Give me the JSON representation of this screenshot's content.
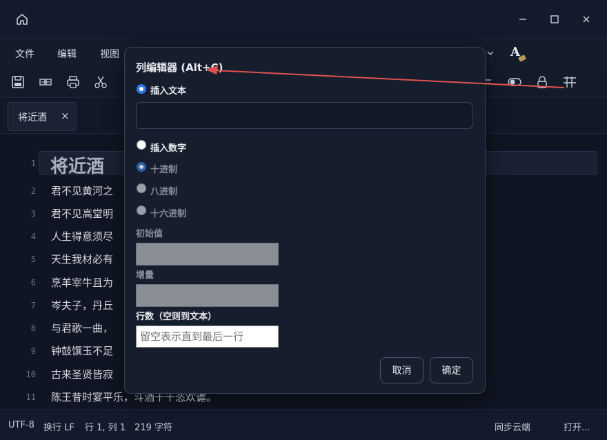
{
  "window": {
    "controls": [
      "minimize-icon",
      "maximize-icon",
      "close-icon"
    ]
  },
  "menubar": {
    "items": [
      "文件",
      "编辑",
      "视图"
    ],
    "font_icon": "A"
  },
  "tab": {
    "label": "将近酒",
    "close": "×"
  },
  "editor": {
    "lines": [
      {
        "num": "1",
        "text": "将近酒"
      },
      {
        "num": "2",
        "text": "君不见黄河之"
      },
      {
        "num": "3",
        "text": "君不见高堂明"
      },
      {
        "num": "4",
        "text": "人生得意须尽"
      },
      {
        "num": "5",
        "text": "天生我材必有"
      },
      {
        "num": "6",
        "text": "烹羊宰牛且为"
      },
      {
        "num": "7",
        "text": "岑夫子，丹丘"
      },
      {
        "num": "8",
        "text": "与君歌一曲，"
      },
      {
        "num": "9",
        "text": "钟鼓馔玉不足"
      },
      {
        "num": "10",
        "text": "古来圣贤皆寂"
      },
      {
        "num": "11",
        "text": "陈王昔时宴平乐，斗酒十千恣欢谑。"
      }
    ]
  },
  "status": {
    "encoding": "UTF-8",
    "eol": "换行 LF",
    "position": "行 1, 列 1",
    "chars": "219 字符",
    "sync": "同步云端",
    "open": "打开..."
  },
  "dialog": {
    "title": "列编辑器 (Alt+C)",
    "insert_text_label": "插入文本",
    "insert_text_value": "",
    "insert_number_label": "插入数字",
    "decimal_label": "十进制",
    "octal_label": "八进制",
    "hex_label": "十六进制",
    "initial_label": "初始值",
    "increment_label": "增量",
    "rows_label": "行数（空则到文本）",
    "rows_placeholder": "留空表示直到最后一行",
    "cancel_label": "取消",
    "confirm_label": "确定"
  },
  "colors": {
    "accent": "#2f7ae5",
    "annotation_arrow": "#e05252"
  }
}
